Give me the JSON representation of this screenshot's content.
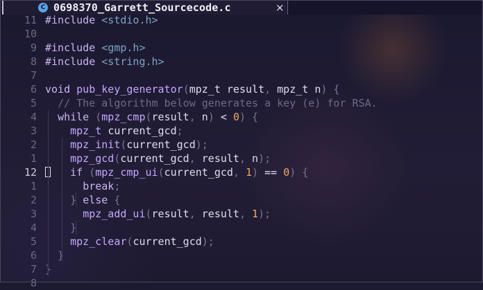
{
  "tab": {
    "icon": "c-language-icon",
    "icon_glyph": "C",
    "title": "0698370_Garrett_Sourcecode.c",
    "close": "×"
  },
  "editor": {
    "lines": [
      {
        "num": "11",
        "tokens": [
          [
            "kw",
            "#include "
          ],
          [
            "hd",
            "<stdio.h>"
          ]
        ]
      },
      {
        "num": "10",
        "tokens": []
      },
      {
        "num": "9",
        "tokens": [
          [
            "kw",
            "#include "
          ],
          [
            "hd",
            "<gmp.h>"
          ]
        ]
      },
      {
        "num": "8",
        "tokens": [
          [
            "kw",
            "#include "
          ],
          [
            "hd",
            "<string.h>"
          ]
        ]
      },
      {
        "num": "7",
        "tokens": []
      },
      {
        "num": "6",
        "tokens": [
          [
            "kw",
            "void "
          ],
          [
            "fn",
            "pub_key_generator"
          ],
          [
            "pn",
            "("
          ],
          [
            "ty",
            "mpz_t result"
          ],
          [
            "pn",
            ", "
          ],
          [
            "ty",
            "mpz_t n"
          ],
          [
            "pn",
            ") {"
          ]
        ]
      },
      {
        "num": "5",
        "tokens": [
          [
            "sp",
            "  "
          ],
          [
            "cm",
            "// The algorithm below generates a key (e) for RSA."
          ]
        ]
      },
      {
        "num": "4",
        "tokens": [
          [
            "sp",
            "  "
          ],
          [
            "kw",
            "while "
          ],
          [
            "pn",
            "("
          ],
          [
            "fn",
            "mpz_cmp"
          ],
          [
            "pn",
            "("
          ],
          [
            "ty",
            "result"
          ],
          [
            "pn",
            ", "
          ],
          [
            "ty",
            "n"
          ],
          [
            "pn",
            ") "
          ],
          [
            "op",
            "< "
          ],
          [
            "num",
            "0"
          ],
          [
            "pn",
            ") {"
          ]
        ]
      },
      {
        "num": "3",
        "tokens": [
          [
            "sp",
            "    "
          ],
          [
            "fn",
            "mpz_t "
          ],
          [
            "ty",
            "current_gcd"
          ],
          [
            "pn",
            ";"
          ]
        ]
      },
      {
        "num": "2",
        "tokens": [
          [
            "sp",
            "    "
          ],
          [
            "fn",
            "mpz_init"
          ],
          [
            "pn",
            "("
          ],
          [
            "ty",
            "current_gcd"
          ],
          [
            "pn",
            ");"
          ]
        ]
      },
      {
        "num": "1",
        "tokens": [
          [
            "sp",
            "    "
          ],
          [
            "fn",
            "mpz_gcd"
          ],
          [
            "pn",
            "("
          ],
          [
            "ty",
            "current_gcd"
          ],
          [
            "pn",
            ", "
          ],
          [
            "ty",
            "result"
          ],
          [
            "pn",
            ", "
          ],
          [
            "ty",
            "n"
          ],
          [
            "pn",
            ");"
          ]
        ]
      },
      {
        "num": "12",
        "current": true,
        "tokens": [
          [
            "sp",
            "    "
          ],
          [
            "kw",
            "if "
          ],
          [
            "pn",
            "("
          ],
          [
            "fn",
            "mpz_cmp_ui"
          ],
          [
            "pn",
            "("
          ],
          [
            "ty",
            "current_gcd"
          ],
          [
            "pn",
            ", "
          ],
          [
            "num",
            "1"
          ],
          [
            "pn",
            ") "
          ],
          [
            "op",
            "== "
          ],
          [
            "num",
            "0"
          ],
          [
            "pn",
            ") {"
          ]
        ]
      },
      {
        "num": "1",
        "tokens": [
          [
            "sp",
            "      "
          ],
          [
            "kw",
            "break"
          ],
          [
            "pn",
            ";"
          ]
        ]
      },
      {
        "num": "2",
        "tokens": [
          [
            "sp",
            "    "
          ],
          [
            "pn",
            "} "
          ],
          [
            "kw",
            "else "
          ],
          [
            "pn",
            "{"
          ]
        ]
      },
      {
        "num": "3",
        "tokens": [
          [
            "sp",
            "      "
          ],
          [
            "fn",
            "mpz_add_ui"
          ],
          [
            "pn",
            "("
          ],
          [
            "ty",
            "result"
          ],
          [
            "pn",
            ", "
          ],
          [
            "ty",
            "result"
          ],
          [
            "pn",
            ", "
          ],
          [
            "num",
            "1"
          ],
          [
            "pn",
            ");"
          ]
        ]
      },
      {
        "num": "4",
        "tokens": [
          [
            "sp",
            "    "
          ],
          [
            "pn",
            "}"
          ]
        ]
      },
      {
        "num": "5",
        "tokens": [
          [
            "sp",
            "    "
          ],
          [
            "fn",
            "mpz_clear"
          ],
          [
            "pn",
            "("
          ],
          [
            "ty",
            "current_gcd"
          ],
          [
            "pn",
            ");"
          ]
        ]
      },
      {
        "num": "6",
        "tokens": [
          [
            "sp",
            "  "
          ],
          [
            "pn",
            "}"
          ]
        ]
      },
      {
        "num": "7",
        "tokens": [
          [
            "pn",
            "}"
          ]
        ]
      },
      {
        "num": "8",
        "tokens": []
      }
    ]
  },
  "colors": {
    "background": "#1c1a30",
    "keyword": "#cbb5f0",
    "function": "#c5a8ff",
    "number": "#f0a860",
    "comment": "#6e6a88",
    "header": "#7fa5c2"
  }
}
